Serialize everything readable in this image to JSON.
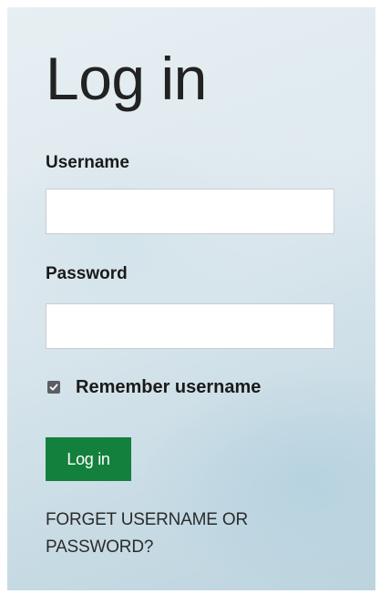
{
  "login_form": {
    "title": "Log in",
    "username_label": "Username",
    "username_value": "",
    "password_label": "Password",
    "password_value": "",
    "remember_label": "Remember username",
    "remember_checked": true,
    "submit_label": "Log in",
    "forgot_link": "FORGET USERNAME OR PASSWORD?"
  },
  "colors": {
    "accent": "#14803d",
    "checkbox": "#5a5f63",
    "text": "#1a1a1a"
  },
  "icons": {
    "checkbox_mark": "check-icon"
  }
}
